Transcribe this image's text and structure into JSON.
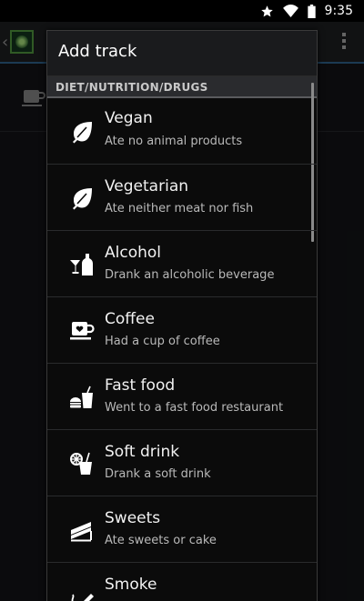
{
  "status_bar": {
    "time": "9:35"
  },
  "dialog": {
    "title": "Add track",
    "section": "DIET/NUTRITION/DRUGS",
    "items": [
      {
        "title": "Vegan",
        "subtitle": "Ate no animal products",
        "icon": "leaf-icon"
      },
      {
        "title": "Vegetarian",
        "subtitle": "Ate neither meat nor fish",
        "icon": "leaf-icon"
      },
      {
        "title": "Alcohol",
        "subtitle": "Drank an alcoholic beverage",
        "icon": "alcohol-icon"
      },
      {
        "title": "Coffee",
        "subtitle": "Had a cup of coffee",
        "icon": "coffee-cup-icon"
      },
      {
        "title": "Fast food",
        "subtitle": "Went to a fast food restaurant",
        "icon": "fast-food-icon"
      },
      {
        "title": "Soft drink",
        "subtitle": "Drank a soft drink",
        "icon": "soft-drink-icon"
      },
      {
        "title": "Sweets",
        "subtitle": "Ate sweets or cake",
        "icon": "cake-icon"
      },
      {
        "title": "Smoke",
        "subtitle": "",
        "icon": "smoke-icon"
      }
    ]
  },
  "colors": {
    "accent": "#2c5a80",
    "dialog_bg": "#0b0b0b",
    "section_bg": "#2a2b2e"
  }
}
